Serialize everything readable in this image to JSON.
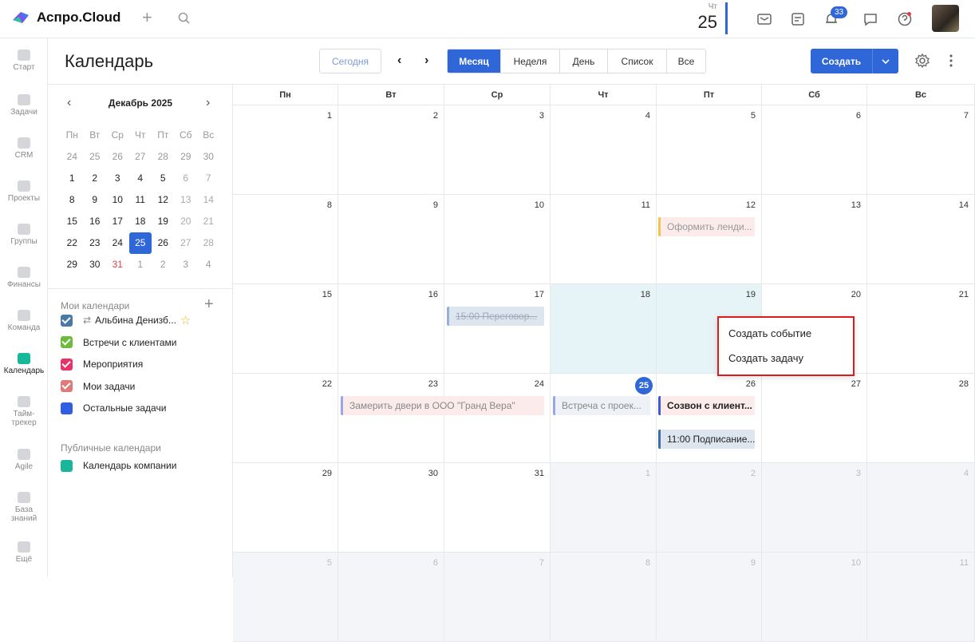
{
  "app": {
    "brand": "Аспро.Cloud"
  },
  "top": {
    "weekday": "Чт",
    "day": "25",
    "notifications": "33"
  },
  "nav": [
    {
      "label": "Старт",
      "icon": "start-icon"
    },
    {
      "label": "Задачи",
      "icon": "tasks-icon"
    },
    {
      "label": "CRM",
      "icon": "crm-icon"
    },
    {
      "label": "Проекты",
      "icon": "projects-icon"
    },
    {
      "label": "Группы",
      "icon": "groups-icon"
    },
    {
      "label": "Финансы",
      "icon": "finance-icon"
    },
    {
      "label": "Команда",
      "icon": "team-icon"
    },
    {
      "label": "Календарь",
      "icon": "calendar-icon"
    },
    {
      "label": "Тайм-",
      "label2": "трекер",
      "icon": "timetracker-icon"
    },
    {
      "label": "Agile",
      "icon": "agile-icon"
    },
    {
      "label": "База",
      "label2": "знаний",
      "icon": "knowledge-icon"
    },
    {
      "label": "Ещё",
      "icon": "more-icon"
    }
  ],
  "header": {
    "title": "Календарь",
    "today": "Сегодня",
    "views": [
      "Месяц",
      "Неделя",
      "День",
      "Список",
      "Все"
    ],
    "active_view": "Месяц",
    "create": "Создать"
  },
  "mini": {
    "title": "Декабрь 2025",
    "weekdays": [
      "Пн",
      "Вт",
      "Ср",
      "Чт",
      "Пт",
      "Сб",
      "Вс"
    ],
    "weeks": [
      [
        "24",
        "25",
        "26",
        "27",
        "28",
        "29",
        "30"
      ],
      [
        "1",
        "2",
        "3",
        "4",
        "5",
        "6",
        "7"
      ],
      [
        "8",
        "9",
        "10",
        "11",
        "12",
        "13",
        "14"
      ],
      [
        "15",
        "16",
        "17",
        "18",
        "19",
        "20",
        "21"
      ],
      [
        "22",
        "23",
        "24",
        "25",
        "26",
        "27",
        "28"
      ],
      [
        "29",
        "30",
        "31",
        "1",
        "2",
        "3",
        "4"
      ]
    ],
    "selected": "25"
  },
  "my_calendars": {
    "title": "Мои календари",
    "items": [
      {
        "label": "Альбина Денизб...",
        "color": "#4a78a8",
        "checked": true,
        "synced": true,
        "star": true
      },
      {
        "label": "Встречи с клиентами",
        "color": "#6dbb3c",
        "checked": true
      },
      {
        "label": "Мероприятия",
        "color": "#e8336a",
        "checked": true
      },
      {
        "label": "Мои задачи",
        "color": "#e07a7a",
        "checked": true
      },
      {
        "label": "Остальные задачи",
        "color": "#2f5fe0",
        "checked": false
      }
    ]
  },
  "public_calendars": {
    "title": "Публичные календари",
    "items": [
      {
        "label": "Календарь компании",
        "color": "#1bb59a",
        "checked": false
      }
    ]
  },
  "grid": {
    "weekdays": [
      "Пн",
      "Вт",
      "Ср",
      "Чт",
      "Пт",
      "Сб",
      "Вс"
    ],
    "weeks": [
      [
        "1",
        "2",
        "3",
        "4",
        "5",
        "6",
        "7"
      ],
      [
        "8",
        "9",
        "10",
        "11",
        "12",
        "13",
        "14"
      ],
      [
        "15",
        "16",
        "17",
        "18",
        "19",
        "20",
        "21"
      ],
      [
        "22",
        "23",
        "24",
        "25",
        "26",
        "27",
        "28"
      ],
      [
        "29",
        "30",
        "31",
        "1",
        "2",
        "3",
        "4"
      ],
      [
        "5",
        "6",
        "7",
        "8",
        "9",
        "10",
        "11"
      ]
    ],
    "today": "25"
  },
  "events": [
    {
      "text": "Оформить ленди...",
      "color": "#f3c64a",
      "bg": "#fbeceb",
      "fg": "#999"
    },
    {
      "text": "15:00 Переговор...",
      "color": "#9ab0cf",
      "bg": "#dde5ef",
      "fg": "#a0aab8",
      "strike": true
    },
    {
      "text": "Замерить двери в ООО \"Гранд Вера\"",
      "color": "#9aa6e8",
      "bg": "#fbeceb",
      "fg": "#888"
    },
    {
      "text": "Встреча с проек...",
      "color": "#9aa6e8",
      "bg": "#eef1f6",
      "fg": "#888"
    },
    {
      "text": "Созвон с клиент...",
      "color": "#3d5bd8",
      "bg": "#fbeceb",
      "fg": "#222",
      "bold": true
    },
    {
      "text": "11:00 Подписание...",
      "color": "#3b6db0",
      "bg": "#dde5ef",
      "fg": "#222"
    }
  ],
  "context_menu": {
    "items": [
      "Создать событие",
      "Создать задачу"
    ]
  }
}
